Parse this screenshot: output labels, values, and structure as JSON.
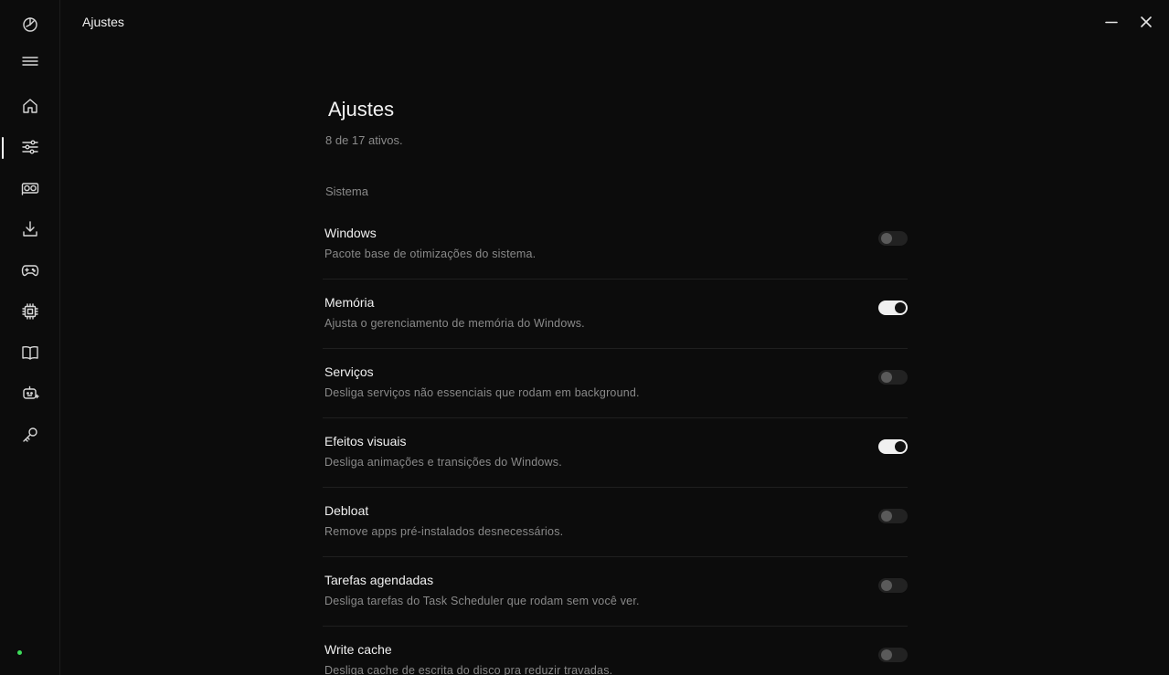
{
  "window": {
    "title": "Ajustes"
  },
  "sidebar": {
    "icons": [
      "logo-icon",
      "menu-icon",
      "home-icon",
      "sliders-icon",
      "gpu-icon",
      "download-icon",
      "gamepad-icon",
      "cpu-icon",
      "book-icon",
      "bot-icon",
      "key-icon"
    ],
    "active": "sliders-icon",
    "status_color": "#3ddc5a"
  },
  "page": {
    "title": "Ajustes",
    "subtitle": "8 de 17 ativos.",
    "section": "Sistema"
  },
  "settings": [
    {
      "title": "Windows",
      "description": "Pacote base de otimizações do sistema.",
      "enabled": false
    },
    {
      "title": "Memória",
      "description": "Ajusta o gerenciamento de memória do Windows.",
      "enabled": true
    },
    {
      "title": "Serviços",
      "description": "Desliga serviços não essenciais que rodam em background.",
      "enabled": false
    },
    {
      "title": "Efeitos visuais",
      "description": "Desliga animações e transições do Windows.",
      "enabled": true
    },
    {
      "title": "Debloat",
      "description": "Remove apps pré-instalados desnecessários.",
      "enabled": false
    },
    {
      "title": "Tarefas agendadas",
      "description": "Desliga tarefas do Task Scheduler que rodam sem você ver.",
      "enabled": false
    },
    {
      "title": "Write cache",
      "description": "Desliga cache de escrita do disco pra reduzir travadas.",
      "enabled": false
    }
  ]
}
